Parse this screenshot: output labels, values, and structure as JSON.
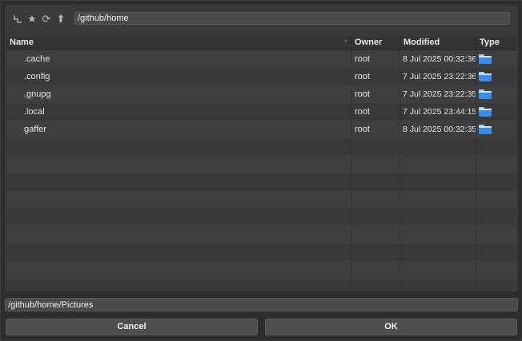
{
  "toolbar": {
    "icons": [
      {
        "name": "hierarchy-icon",
        "glyph": "⮤"
      },
      {
        "name": "bookmark-star-icon",
        "glyph": "★"
      },
      {
        "name": "refresh-icon",
        "glyph": "⟳"
      },
      {
        "name": "up-arrow-icon",
        "glyph": "⬆"
      }
    ],
    "path_value": "/github/home"
  },
  "table": {
    "columns": [
      "Name",
      "Owner",
      "Modified",
      "Type"
    ],
    "sort_indicator": "^",
    "rows": [
      {
        "name": ".cache",
        "owner": "root",
        "modified": "8 Jul 2025 00:32:36",
        "type_icon": "folder-icon"
      },
      {
        "name": ".config",
        "owner": "root",
        "modified": "7 Jul 2025 23:22:36",
        "type_icon": "folder-icon"
      },
      {
        "name": ".gnupg",
        "owner": "root",
        "modified": "7 Jul 2025 23:22:35",
        "type_icon": "folder-icon"
      },
      {
        "name": ".local",
        "owner": "root",
        "modified": "7 Jul 2025 23:44:15",
        "type_icon": "folder-icon"
      },
      {
        "name": "gaffer",
        "owner": "root",
        "modified": "8 Jul 2025 00:32:35",
        "type_icon": "folder-icon"
      }
    ],
    "empty_rows": 9
  },
  "selection_path": "/github/home/Pictures",
  "buttons": {
    "cancel_label": "Cancel",
    "ok_label": "OK"
  },
  "colors": {
    "folder": "#3a8ee6",
    "background": "#2d2d2d",
    "panel": "#3a3a3a"
  }
}
